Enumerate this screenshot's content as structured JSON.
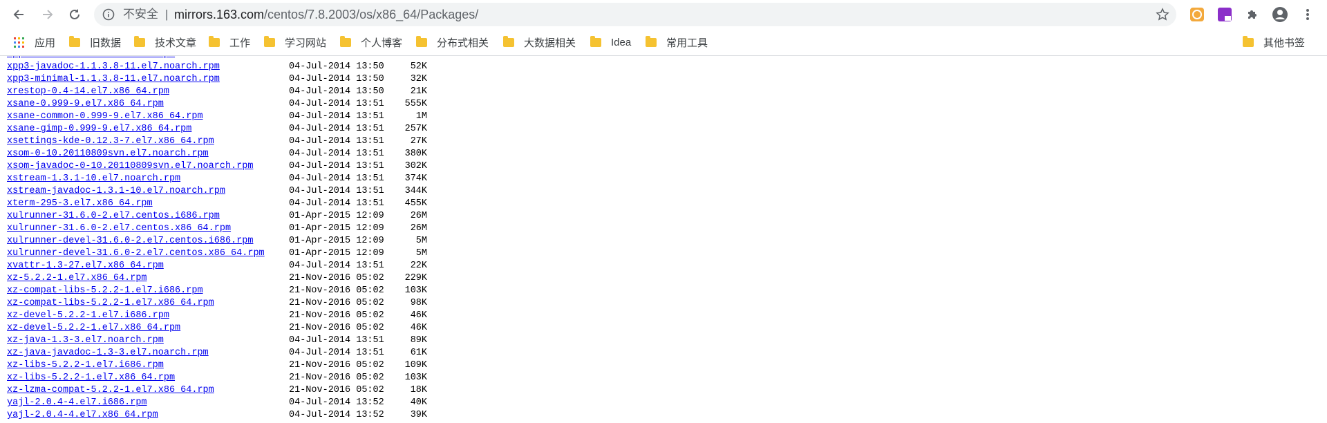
{
  "browser": {
    "security_label": "不安全",
    "separator": "|",
    "url_host": "mirrors.163.com",
    "url_path": "/centos/7.8.2003/os/x86_64/Packages/"
  },
  "bookmarks": [
    {
      "label": "应用",
      "icon": "apps-grid-icon"
    },
    {
      "label": "旧数据",
      "icon": "folder-icon"
    },
    {
      "label": "技术文章",
      "icon": "folder-icon"
    },
    {
      "label": "工作",
      "icon": "folder-icon"
    },
    {
      "label": "学习网站",
      "icon": "folder-icon"
    },
    {
      "label": "个人博客",
      "icon": "folder-icon"
    },
    {
      "label": "分布式相关",
      "icon": "folder-icon"
    },
    {
      "label": "大数据相关",
      "icon": "folder-icon"
    },
    {
      "label": "Idea",
      "icon": "folder-icon"
    },
    {
      "label": "常用工具",
      "icon": "folder-icon"
    }
  ],
  "other_bookmarks": "其他书签",
  "files": [
    {
      "name": "xpp3-javadoc-1.1.3.8-11.el7.noarch.rpm",
      "date": "04-Jul-2014 13:50",
      "size": "52K"
    },
    {
      "name": "xpp3-minimal-1.1.3.8-11.el7.noarch.rpm",
      "date": "04-Jul-2014 13:50",
      "size": "32K"
    },
    {
      "name": "xrestop-0.4-14.el7.x86_64.rpm",
      "date": "04-Jul-2014 13:50",
      "size": "21K"
    },
    {
      "name": "xsane-0.999-9.el7.x86_64.rpm",
      "date": "04-Jul-2014 13:51",
      "size": "555K"
    },
    {
      "name": "xsane-common-0.999-9.el7.x86_64.rpm",
      "date": "04-Jul-2014 13:51",
      "size": "1M"
    },
    {
      "name": "xsane-gimp-0.999-9.el7.x86_64.rpm",
      "date": "04-Jul-2014 13:51",
      "size": "257K"
    },
    {
      "name": "xsettings-kde-0.12.3-7.el7.x86_64.rpm",
      "date": "04-Jul-2014 13:51",
      "size": "27K"
    },
    {
      "name": "xsom-0-10.20110809svn.el7.noarch.rpm",
      "date": "04-Jul-2014 13:51",
      "size": "380K"
    },
    {
      "name": "xsom-javadoc-0-10.20110809svn.el7.noarch.rpm",
      "date": "04-Jul-2014 13:51",
      "size": "302K"
    },
    {
      "name": "xstream-1.3.1-10.el7.noarch.rpm",
      "date": "04-Jul-2014 13:51",
      "size": "374K"
    },
    {
      "name": "xstream-javadoc-1.3.1-10.el7.noarch.rpm",
      "date": "04-Jul-2014 13:51",
      "size": "344K"
    },
    {
      "name": "xterm-295-3.el7.x86_64.rpm",
      "date": "04-Jul-2014 13:51",
      "size": "455K"
    },
    {
      "name": "xulrunner-31.6.0-2.el7.centos.i686.rpm",
      "date": "01-Apr-2015 12:09",
      "size": "26M"
    },
    {
      "name": "xulrunner-31.6.0-2.el7.centos.x86_64.rpm",
      "date": "01-Apr-2015 12:09",
      "size": "26M"
    },
    {
      "name": "xulrunner-devel-31.6.0-2.el7.centos.i686.rpm",
      "date": "01-Apr-2015 12:09",
      "size": "5M"
    },
    {
      "name": "xulrunner-devel-31.6.0-2.el7.centos.x86_64.rpm",
      "date": "01-Apr-2015 12:09",
      "size": "5M"
    },
    {
      "name": "xvattr-1.3-27.el7.x86_64.rpm",
      "date": "04-Jul-2014 13:51",
      "size": "22K"
    },
    {
      "name": "xz-5.2.2-1.el7.x86_64.rpm",
      "date": "21-Nov-2016 05:02",
      "size": "229K"
    },
    {
      "name": "xz-compat-libs-5.2.2-1.el7.i686.rpm",
      "date": "21-Nov-2016 05:02",
      "size": "103K"
    },
    {
      "name": "xz-compat-libs-5.2.2-1.el7.x86_64.rpm",
      "date": "21-Nov-2016 05:02",
      "size": "98K"
    },
    {
      "name": "xz-devel-5.2.2-1.el7.i686.rpm",
      "date": "21-Nov-2016 05:02",
      "size": "46K"
    },
    {
      "name": "xz-devel-5.2.2-1.el7.x86_64.rpm",
      "date": "21-Nov-2016 05:02",
      "size": "46K"
    },
    {
      "name": "xz-java-1.3-3.el7.noarch.rpm",
      "date": "04-Jul-2014 13:51",
      "size": "89K"
    },
    {
      "name": "xz-java-javadoc-1.3-3.el7.noarch.rpm",
      "date": "04-Jul-2014 13:51",
      "size": "61K"
    },
    {
      "name": "xz-libs-5.2.2-1.el7.i686.rpm",
      "date": "21-Nov-2016 05:02",
      "size": "109K"
    },
    {
      "name": "xz-libs-5.2.2-1.el7.x86_64.rpm",
      "date": "21-Nov-2016 05:02",
      "size": "103K"
    },
    {
      "name": "xz-lzma-compat-5.2.2-1.el7.x86_64.rpm",
      "date": "21-Nov-2016 05:02",
      "size": "18K"
    },
    {
      "name": "yajl-2.0.4-4.el7.i686.rpm",
      "date": "04-Jul-2014 13:52",
      "size": "40K"
    },
    {
      "name": "yajl-2.0.4-4.el7.x86_64.rpm",
      "date": "04-Jul-2014 13:52",
      "size": "39K"
    }
  ]
}
